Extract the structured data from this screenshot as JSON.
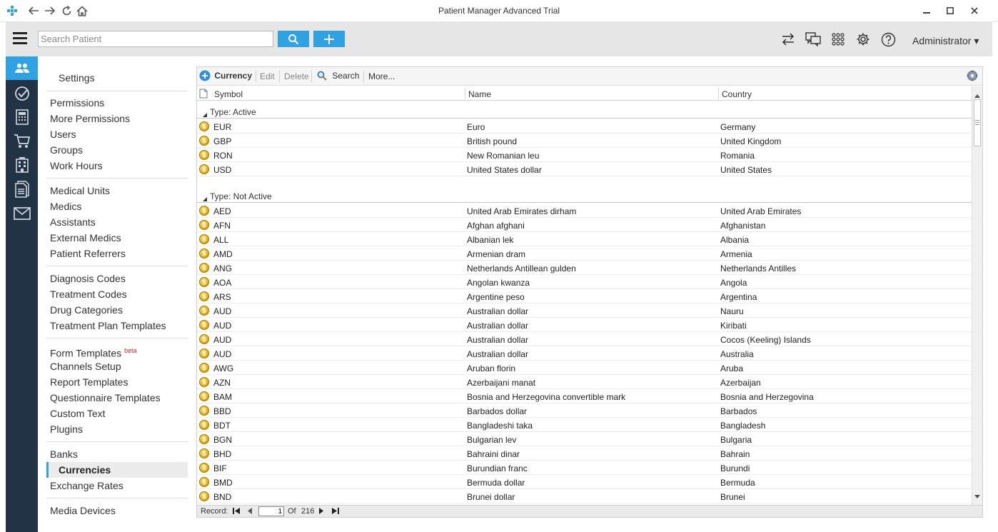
{
  "window": {
    "title": "Patient Manager Advanced Trial",
    "minimize": "—",
    "maximize": "▢",
    "close": "✕"
  },
  "toolbar": {
    "search_placeholder": "Search Patient",
    "user": "Administrator ▾"
  },
  "settings": {
    "title": "Settings",
    "groups": [
      [
        "Permissions",
        "More Permissions",
        "Users",
        "Groups",
        "Work Hours"
      ],
      [
        "Medical Units",
        "Medics",
        "Assistants",
        "External Medics",
        "Patient Referrers"
      ],
      [
        "Diagnosis Codes",
        "Treatment Codes",
        "Drug Categories",
        "Treatment Plan Templates"
      ],
      [
        "Form Templates",
        "Channels Setup",
        "Report Templates",
        "Questionnaire Templates",
        "Custom Text",
        "Plugins"
      ],
      [
        "Banks",
        "Currencies",
        "Exchange Rates"
      ],
      [
        "Media Devices"
      ]
    ],
    "beta_label": "beta",
    "selected": "Currencies"
  },
  "grid_toolbar": {
    "add": "Currency",
    "edit": "Edit",
    "delete": "Delete",
    "search": "Search",
    "more": "More..."
  },
  "columns": {
    "symbol": "Symbol",
    "name": "Name",
    "country": "Country"
  },
  "groups": [
    {
      "label": "Type: Active",
      "rows": [
        [
          "EUR",
          "Euro",
          "Germany"
        ],
        [
          "GBP",
          "British pound",
          "United Kingdom"
        ],
        [
          "RON",
          "New Romanian leu",
          "Romania"
        ],
        [
          "USD",
          "United States dollar",
          "United States"
        ]
      ]
    },
    {
      "label": "Type: Not Active",
      "rows": [
        [
          "AED",
          "United Arab Emirates dirham",
          "United Arab Emirates"
        ],
        [
          "AFN",
          "Afghan afghani",
          "Afghanistan"
        ],
        [
          "ALL",
          "Albanian lek",
          "Albania"
        ],
        [
          "AMD",
          "Armenian dram",
          "Armenia"
        ],
        [
          "ANG",
          "Netherlands Antillean gulden",
          "Netherlands Antilles"
        ],
        [
          "AOA",
          "Angolan kwanza",
          "Angola"
        ],
        [
          "ARS",
          "Argentine peso",
          "Argentina"
        ],
        [
          "AUD",
          "Australian dollar",
          "Nauru"
        ],
        [
          "AUD",
          "Australian dollar",
          "Kiribati"
        ],
        [
          "AUD",
          "Australian dollar",
          "Cocos (Keeling) Islands"
        ],
        [
          "AUD",
          "Australian dollar",
          "Australia"
        ],
        [
          "AWG",
          "Aruban florin",
          "Aruba"
        ],
        [
          "AZN",
          "Azerbaijani manat",
          "Azerbaijan"
        ],
        [
          "BAM",
          "Bosnia and Herzegovina convertible mark",
          "Bosnia and Herzegovina"
        ],
        [
          "BBD",
          "Barbados dollar",
          "Barbados"
        ],
        [
          "BDT",
          "Bangladeshi taka",
          "Bangladesh"
        ],
        [
          "BGN",
          "Bulgarian lev",
          "Bulgaria"
        ],
        [
          "BHD",
          "Bahraini dinar",
          "Bahrain"
        ],
        [
          "BIF",
          "Burundian franc",
          "Burundi"
        ],
        [
          "BMD",
          "Bermuda dollar",
          "Bermuda"
        ],
        [
          "BND",
          "Brunei dollar",
          "Brunei"
        ]
      ]
    }
  ],
  "pager": {
    "label": "Record:",
    "current": "1",
    "of": "Of",
    "total": "216"
  },
  "colors": {
    "accent": "#2fa2e3",
    "sidebar": "#233346",
    "toolbar_bg": "#e6e6e6"
  }
}
